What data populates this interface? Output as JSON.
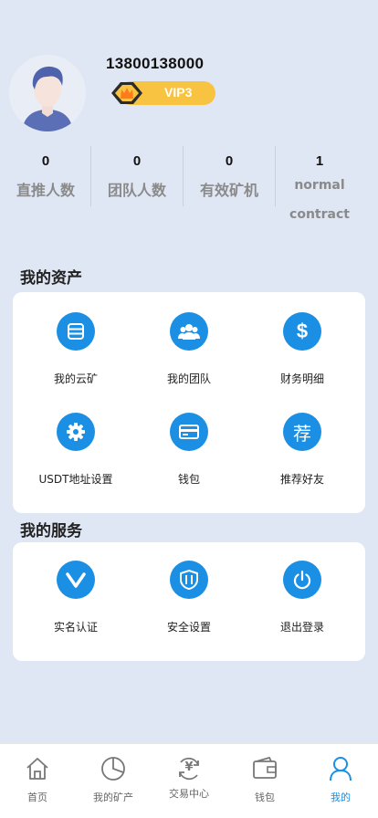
{
  "user": {
    "phone": "13800138000",
    "vip_level": "VIP3"
  },
  "stats": [
    {
      "value": "0",
      "label": "直推人数"
    },
    {
      "value": "0",
      "label": "团队人数"
    },
    {
      "value": "0",
      "label": "有效矿机"
    },
    {
      "value": "1",
      "label": "normal contract"
    }
  ],
  "assets": {
    "title": "我的资产",
    "items": [
      {
        "label": "我的云矿",
        "icon": "database-icon"
      },
      {
        "label": "我的团队",
        "icon": "team-icon"
      },
      {
        "label": "财务明细",
        "icon": "dollar-icon"
      },
      {
        "label": "USDT地址设置",
        "icon": "gear-icon"
      },
      {
        "label": "钱包",
        "icon": "card-icon"
      },
      {
        "label": "推荐好友",
        "icon": "recommend-icon",
        "glyph": "荐"
      }
    ]
  },
  "services": {
    "title": "我的服务",
    "items": [
      {
        "label": "实名认证",
        "icon": "verify-icon"
      },
      {
        "label": "安全设置",
        "icon": "shield-icon"
      },
      {
        "label": "退出登录",
        "icon": "power-icon"
      }
    ]
  },
  "tabbar": {
    "items": [
      {
        "label": "首页",
        "icon": "home-icon"
      },
      {
        "label": "我的矿产",
        "icon": "pie-chart-icon"
      },
      {
        "label": "交易中心",
        "icon": "exchange-icon",
        "glyph": "¥"
      },
      {
        "label": "钱包",
        "icon": "wallet-icon"
      },
      {
        "label": "我的",
        "icon": "user-icon"
      }
    ],
    "active_index": 4
  },
  "colors": {
    "background": "#dfe6f4",
    "accent": "#1a8fe3",
    "vip_gold": "#f8c340"
  }
}
